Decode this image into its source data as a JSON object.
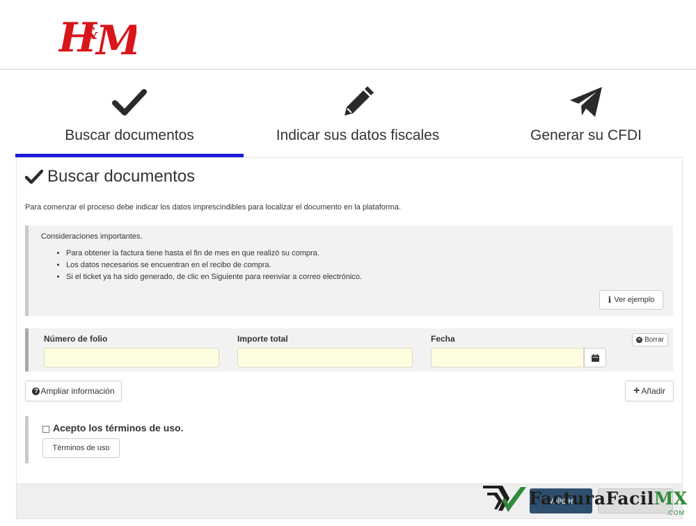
{
  "brand": {
    "logo_text": "H&M",
    "logo_color": "#d9151c"
  },
  "steps": [
    {
      "label": "Buscar documentos",
      "icon": "check-icon",
      "active": true
    },
    {
      "label": "Indicar sus datos fiscales",
      "icon": "pencil-icon",
      "active": false
    },
    {
      "label": "Generar su CFDI",
      "icon": "paper-plane-icon",
      "active": false
    }
  ],
  "panel": {
    "title": "Buscar documentos",
    "intro": "Para comenzar el proceso debe indicar los datos imprescindibles para localizar el documento en la plataforma.",
    "notes_title": "Consideraciones importantes.",
    "notes": [
      "Para obtener la factura tiene hasta el fin de mes en que realizó su compra.",
      "Los datos necesarios se encuentran en el recibo de compra.",
      "Si el ticket ya ha sido generado, de clic en Siguiente para reenviar a correo electrónico."
    ],
    "ver_ejemplo": "Ver ejemplo"
  },
  "fields": {
    "folio": {
      "label": "Número de folio",
      "value": ""
    },
    "importe": {
      "label": "Importe total",
      "value": ""
    },
    "fecha": {
      "label": "Fecha",
      "value": ""
    },
    "borrar": "Borrar"
  },
  "actions": {
    "ampliar": "Ampliar información",
    "anadir": "Añadir"
  },
  "terms": {
    "accept_label": "Acepto los términos de uso.",
    "button": "Términos de uso"
  },
  "footer": {
    "validar": "Validar"
  },
  "watermark": {
    "name": "FacturaFacil",
    "suffix": "MX",
    "domain": ".COM"
  },
  "colors": {
    "active_step": "#1c1ce0",
    "input_bg": "#fffde0",
    "primary_button": "#2f4f6f"
  }
}
